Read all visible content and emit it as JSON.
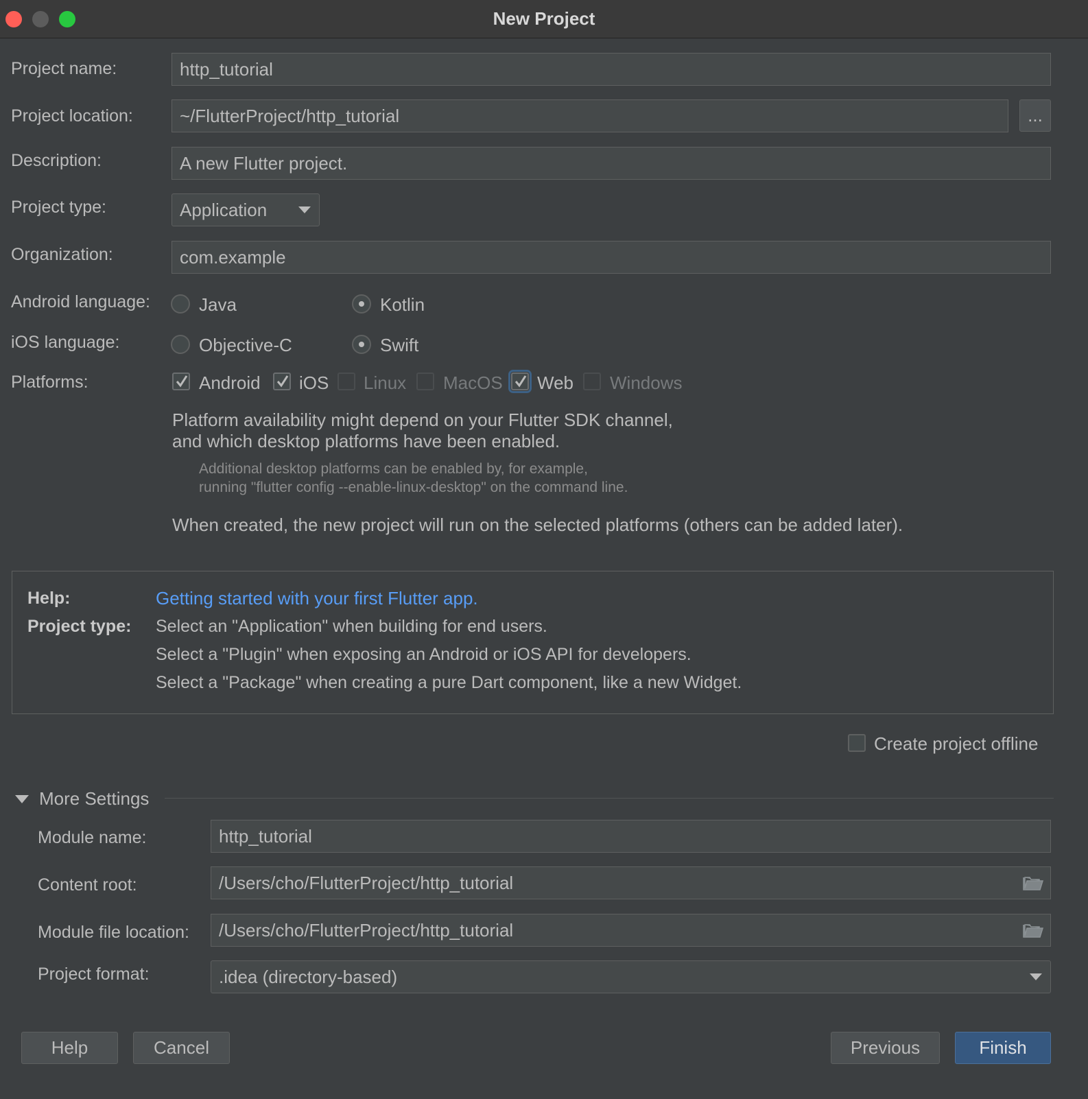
{
  "window": {
    "title": "New Project"
  },
  "form": {
    "project_name": {
      "label": "Project name:",
      "value": "http_tutorial"
    },
    "project_location": {
      "label": "Project location:",
      "value": "~/FlutterProject/http_tutorial",
      "browse_label": "..."
    },
    "description": {
      "label": "Description:",
      "value": "A new Flutter project."
    },
    "project_type": {
      "label": "Project type:",
      "value": "Application"
    },
    "organization": {
      "label": "Organization:",
      "value": "com.example"
    },
    "android_language": {
      "label": "Android language:",
      "options": [
        "Java",
        "Kotlin"
      ],
      "selected": "Kotlin"
    },
    "ios_language": {
      "label": "iOS language:",
      "options": [
        "Objective-C",
        "Swift"
      ],
      "selected": "Swift"
    },
    "platforms": {
      "label": "Platforms:",
      "items": [
        {
          "label": "Android",
          "checked": true,
          "enabled": true
        },
        {
          "label": "iOS",
          "checked": true,
          "enabled": true
        },
        {
          "label": "Linux",
          "checked": false,
          "enabled": false
        },
        {
          "label": "MacOS",
          "checked": false,
          "enabled": false
        },
        {
          "label": "Web",
          "checked": true,
          "enabled": true
        },
        {
          "label": "Windows",
          "checked": false,
          "enabled": false
        }
      ]
    },
    "platform_note_line1": "Platform availability might depend on your Flutter SDK channel,",
    "platform_note_line2": "and which desktop platforms have been enabled.",
    "platform_small_line1": "Additional desktop platforms can be enabled by, for example,",
    "platform_small_line2": "running \"flutter config --enable-linux-desktop\" on the command line.",
    "created_note": "When created, the new project will run on the selected platforms (others can be added later)."
  },
  "help": {
    "help_label": "Help:",
    "help_link": "Getting started with your first Flutter app.",
    "type_label": "Project type:",
    "lines": [
      "Select an \"Application\" when building for end users.",
      "Select a \"Plugin\" when exposing an Android or iOS API for developers.",
      "Select a \"Package\" when creating a pure Dart component, like a new Widget."
    ]
  },
  "offline": {
    "label": "Create project offline",
    "checked": false
  },
  "more_settings": {
    "title": "More Settings",
    "module_name": {
      "label": "Module name:",
      "value": "http_tutorial"
    },
    "content_root": {
      "label": "Content root:",
      "value": "/Users/cho/FlutterProject/http_tutorial"
    },
    "module_file_location": {
      "label": "Module file location:",
      "value": "/Users/cho/FlutterProject/http_tutorial"
    },
    "project_format": {
      "label": "Project format:",
      "value": ".idea (directory-based)"
    }
  },
  "buttons": {
    "help": "Help",
    "cancel": "Cancel",
    "previous": "Previous",
    "finish": "Finish"
  },
  "colors": {
    "close": "#ff5f57",
    "minimize": "#5c5c5c",
    "maximize": "#28c840",
    "accent": "#365880",
    "link": "#589df6"
  }
}
